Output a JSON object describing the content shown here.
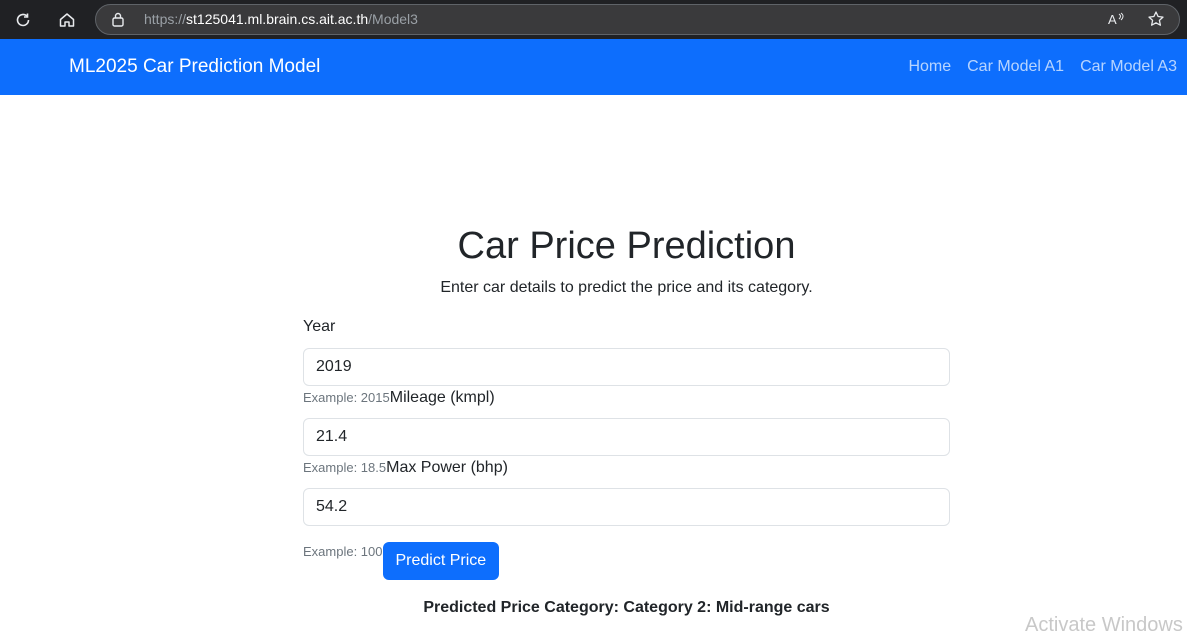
{
  "browser": {
    "url_prefix": "https://",
    "url_host": "st125041.ml.brain.cs.ait.ac.th",
    "url_path": "/Model3"
  },
  "navbar": {
    "brand": "ML2025 Car Prediction Model",
    "links": [
      "Home",
      "Car Model A1",
      "Car Model A3"
    ]
  },
  "page": {
    "title": "Car Price Prediction",
    "subtitle": "Enter car details to predict the price and its category."
  },
  "form": {
    "year": {
      "label": "Year",
      "value": "2019",
      "hint": "Example: 2015"
    },
    "mileage": {
      "label": "Mileage (kmpl)",
      "value": "21.4",
      "hint": "Example: 18.5"
    },
    "max_power": {
      "label": "Max Power (bhp)",
      "value": "54.2",
      "hint": "Example: 100"
    },
    "submit_label": "Predict Price"
  },
  "result": {
    "text": "Predicted Price Category: Category 2: Mid-range cars"
  },
  "watermark": "Activate Windows",
  "colors": {
    "primary": "#0d6efd",
    "chrome": "#202124"
  }
}
